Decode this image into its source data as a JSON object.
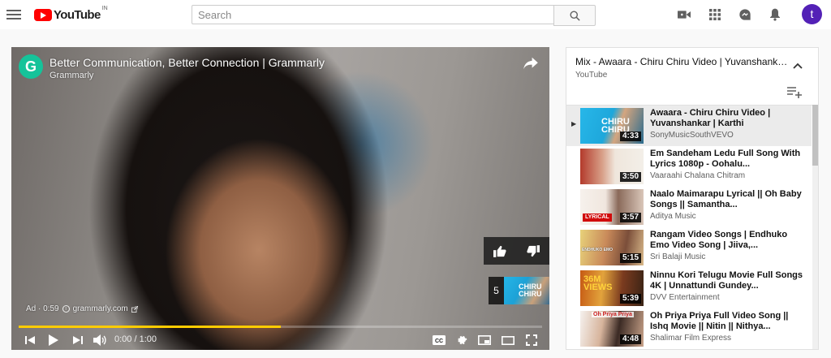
{
  "colors": {
    "brand": "#ff0000",
    "accent_progress": "#ffcc00",
    "avatar": "#5321b6",
    "grammarly": "#15c39a"
  },
  "header": {
    "logo_text": "YouTube",
    "logo_region": "IN",
    "search": {
      "placeholder": "Search",
      "value": ""
    },
    "avatar_letter": "t",
    "icons": [
      "menu-icon",
      "search-icon",
      "create-video-icon",
      "apps-grid-icon",
      "messages-icon",
      "notifications-bell-icon"
    ]
  },
  "player": {
    "ad": {
      "logo_letter": "G",
      "title": "Better Communication, Better Connection | Grammarly",
      "channel": "Grammarly",
      "timer": "Ad · 0:59",
      "site": "grammarly.com"
    },
    "next_count": "5",
    "next_thumb_text": "CHIRU CHIRU",
    "progress_fraction": 0.5,
    "time": "0:00 / 1:00"
  },
  "playlist": {
    "title": "Mix - Awaara - Chiru Chiru Video | Yuvanshankar | Karthi",
    "channel": "YouTube",
    "items": [
      {
        "title": "Awaara - Chiru Chiru Video | Yuvanshankar | Karthi",
        "channel": "SonyMusicSouthVEVO",
        "duration": "4:33",
        "indicator": "▶",
        "thumb_text": "CHIRU CHIRU"
      },
      {
        "title": "Em Sandeham Ledu Full Song With Lyrics 1080p - Oohalu...",
        "channel": "Vaaraahi Chalana Chitram",
        "duration": "3:50",
        "indicator": "",
        "thumb_text": ""
      },
      {
        "title": "Naalo Maimarapu Lyrical || Oh Baby Songs || Samantha...",
        "channel": "Aditya Music",
        "duration": "3:57",
        "indicator": "",
        "thumb_text": "LYRICAL"
      },
      {
        "title": "Rangam Video Songs | Endhuko Emo Video Song | Jiiva,...",
        "channel": "Sri Balaji Music",
        "duration": "5:15",
        "indicator": "",
        "thumb_text": "ENDHUKO EMO"
      },
      {
        "title": "Ninnu Kori Telugu Movie Full Songs 4K | Unnattundi Gundey...",
        "channel": "DVV Entertainment",
        "duration": "5:39",
        "indicator": "",
        "thumb_text": "36M VIEWS"
      },
      {
        "title": "Oh Priya Priya Full Video Song || Ishq Movie || Nitin || Nithya...",
        "channel": "Shalimar Film Express",
        "duration": "4:48",
        "indicator": "",
        "thumb_text": "Oh Priya Priya"
      }
    ]
  }
}
